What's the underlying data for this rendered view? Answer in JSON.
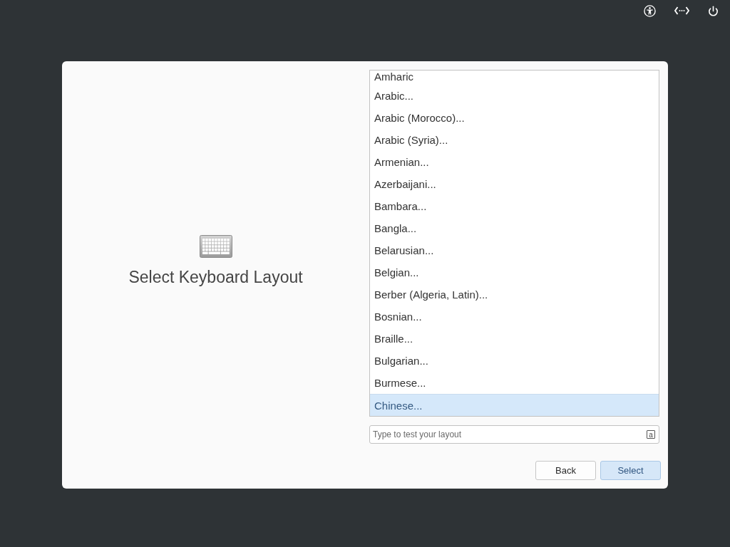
{
  "dialog": {
    "title": "Select Keyboard Layout"
  },
  "layout_list": {
    "items": [
      {
        "label": "Amharic",
        "selected": false
      },
      {
        "label": "Arabic...",
        "selected": false
      },
      {
        "label": "Arabic (Morocco)...",
        "selected": false
      },
      {
        "label": "Arabic (Syria)...",
        "selected": false
      },
      {
        "label": "Armenian...",
        "selected": false
      },
      {
        "label": "Azerbaijani...",
        "selected": false
      },
      {
        "label": "Bambara...",
        "selected": false
      },
      {
        "label": "Bangla...",
        "selected": false
      },
      {
        "label": "Belarusian...",
        "selected": false
      },
      {
        "label": "Belgian...",
        "selected": false
      },
      {
        "label": "Berber (Algeria, Latin)...",
        "selected": false
      },
      {
        "label": "Bosnian...",
        "selected": false
      },
      {
        "label": "Braille...",
        "selected": false
      },
      {
        "label": "Bulgarian...",
        "selected": false
      },
      {
        "label": "Burmese...",
        "selected": false
      },
      {
        "label": "Chinese...",
        "selected": true
      }
    ]
  },
  "test_field": {
    "placeholder": "Type to test your layout",
    "layout_indicator": "a"
  },
  "buttons": [
    {
      "label": "Back",
      "kind": "default"
    },
    {
      "label": "Select",
      "kind": "suggested"
    }
  ]
}
